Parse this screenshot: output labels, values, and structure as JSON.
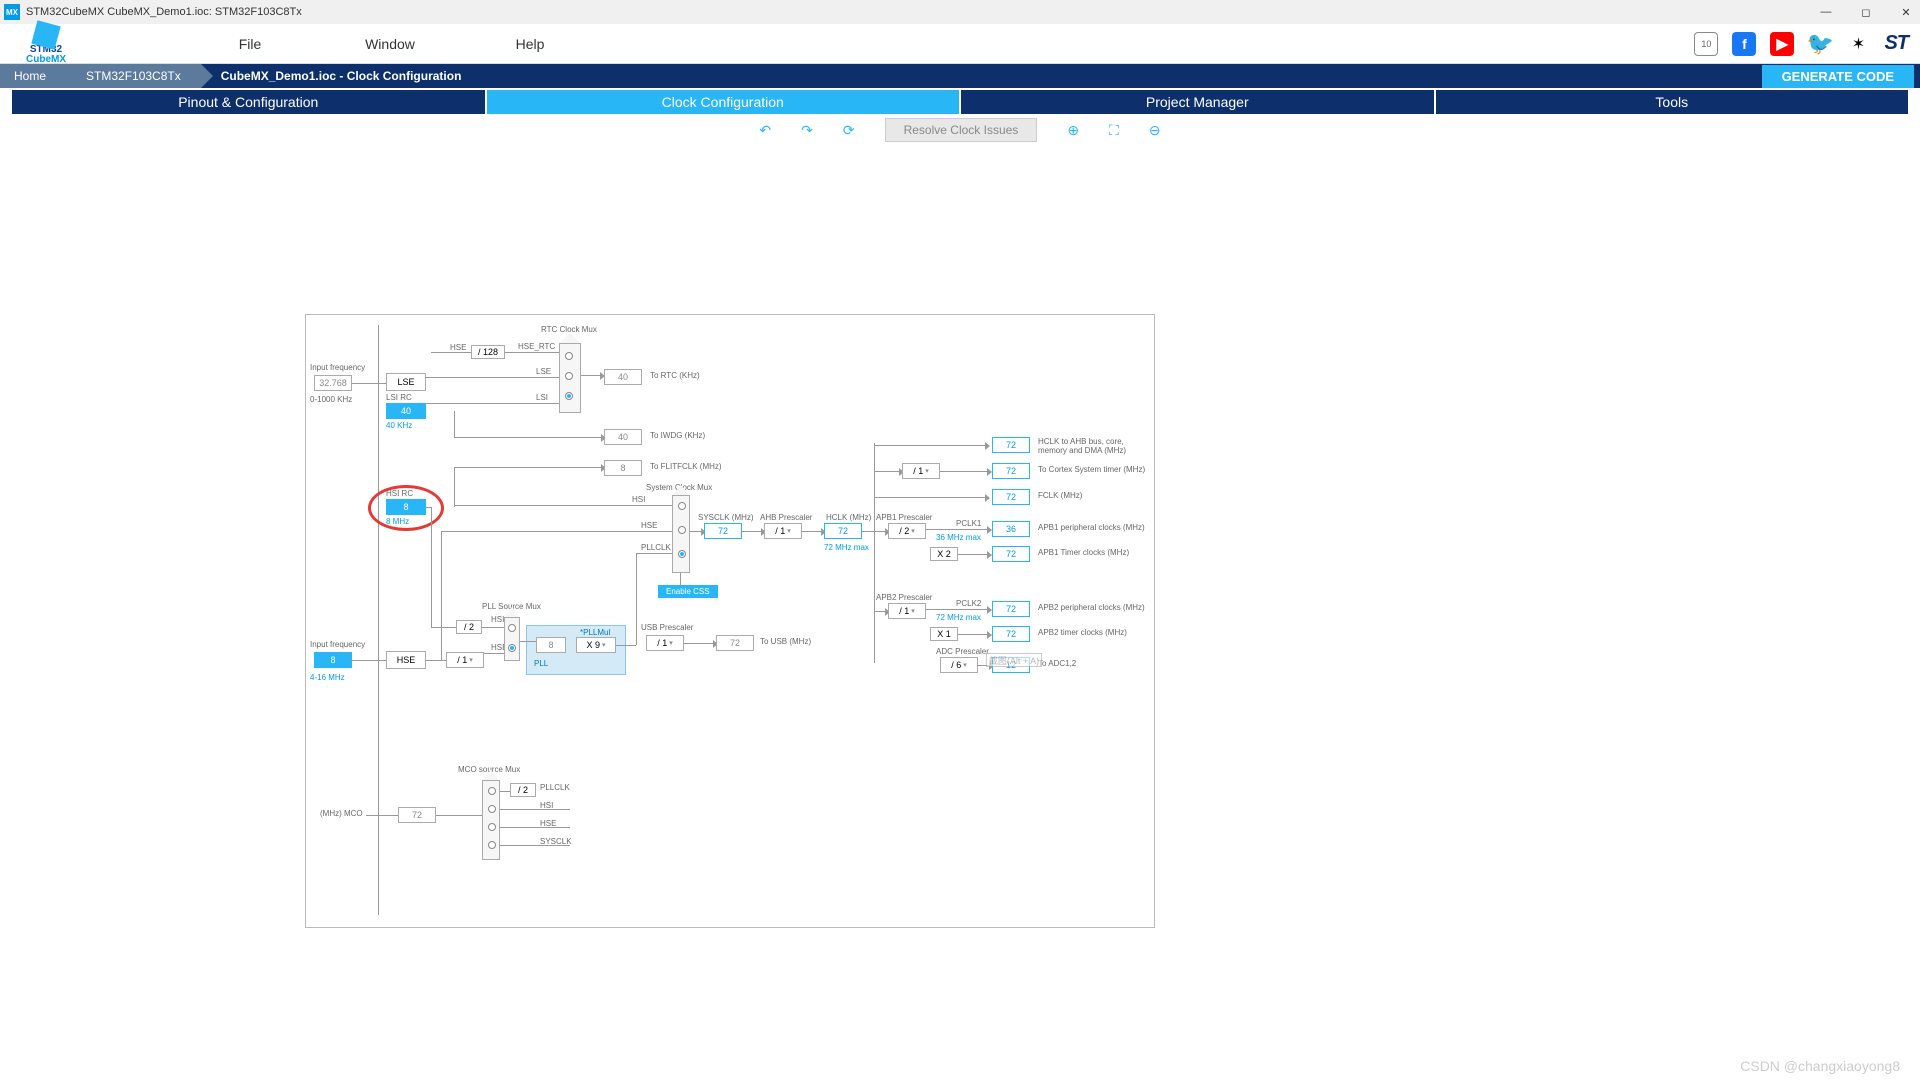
{
  "window": {
    "title": "STM32CubeMX CubeMX_Demo1.ioc: STM32F103C8Tx"
  },
  "logo": {
    "l1": "STM32",
    "l2": "CubeMX"
  },
  "menu": {
    "file": "File",
    "window": "Window",
    "help": "Help"
  },
  "social": {
    "badge": "10",
    "fb": "f",
    "yt": "▶",
    "tw": "🐦",
    "st": "ST"
  },
  "breadcrumb": {
    "home": "Home",
    "mcu": "STM32F103C8Tx",
    "proj": "CubeMX_Demo1.ioc - Clock Configuration",
    "gen": "GENERATE CODE"
  },
  "tabs": {
    "pinout": "Pinout & Configuration",
    "clock": "Clock Configuration",
    "pm": "Project Manager",
    "tools": "Tools"
  },
  "toolbar": {
    "resolve": "Resolve Clock Issues"
  },
  "clk": {
    "lse_in_lbl": "Input frequency",
    "lse_in": "32.768",
    "lse_range": "0-1000 KHz",
    "lse": "LSE",
    "lsi_lbl": "LSI RC",
    "lsi": "40",
    "lsi_note": "40 KHz",
    "hse_div128": "/ 128",
    "rtc_mux": "RTC Clock Mux",
    "rtc_to": "To RTC (KHz)",
    "rtc_val": "40",
    "iwdg_to": "To IWDG (KHz)",
    "iwdg_val": "40",
    "hsi_lbl": "HSI RC",
    "hsi": "8",
    "hsi_note": "8 MHz",
    "flitf_val": "8",
    "flitf_to": "To FLITFCLK (MHz)",
    "hse_in_lbl": "Input frequency",
    "hse_in": "8",
    "hse_range": "4-16 MHz",
    "hse": "HSE",
    "hse_div": "/ 1",
    "pll_src": "PLL Source Mux",
    "hsi_div2": "/ 2",
    "hsi_sig": "HSI",
    "hse_sig": "HSE",
    "pllmul_lbl": "*PLLMul",
    "pll_in": "8",
    "pllmul": "X 9",
    "pll": "PLL",
    "sys_mux": "System Clock Mux",
    "s_hsi": "HSI",
    "s_hse": "HSE",
    "s_pll": "PLLCLK",
    "sysclk_lbl": "SYSCLK (MHz)",
    "sysclk": "72",
    "ahb_lbl": "AHB Prescaler",
    "ahb": "/ 1",
    "hclk_lbl": "HCLK (MHz)",
    "hclk": "72",
    "hclk_max": "72 MHz max",
    "enable_css": "Enable CSS",
    "usb_lbl": "USB Prescaler",
    "usb_div": "/ 1",
    "usb_val": "72",
    "usb_to": "To USB (MHz)",
    "apb1_lbl": "APB1 Prescaler",
    "apb1": "/ 2",
    "apb1_max": "36 MHz max",
    "pclk1_lbl": "PCLK1",
    "apb1_x2": "X 2",
    "apb2_lbl": "APB2 Prescaler",
    "apb2": "/ 1",
    "apb2_max": "72 MHz max",
    "pclk2_lbl": "PCLK2",
    "apb2_x1": "X 1",
    "adc_lbl": "ADC Prescaler",
    "adc": "/ 6",
    "ahb_div1": "/ 1",
    "out_hclk": "72",
    "out_hclk_to": "HCLK to AHB bus, core, memory and DMA (MHz)",
    "out_cortex": "72",
    "out_cortex_to": "To Cortex System timer (MHz)",
    "out_fclk": "72",
    "out_fclk_to": "FCLK (MHz)",
    "out_pclk1": "36",
    "out_pclk1_to": "APB1 peripheral clocks (MHz)",
    "out_tim1": "72",
    "out_tim1_to": "APB1 Timer clocks (MHz)",
    "out_pclk2": "72",
    "out_pclk2_to": "APB2 peripheral clocks (MHz)",
    "out_tim2": "72",
    "out_tim2_to": "APB2 timer clocks (MHz)",
    "out_adc": "12",
    "out_adc_to": "To ADC1,2",
    "mco_lbl": "MCO source Mux",
    "mco_div2": "/ 2",
    "mco_pll": "PLLCLK",
    "mco_hsi": "HSI",
    "mco_hse": "HSE",
    "mco_sys": "SYSCLK",
    "mco_out_lbl": "(MHz) MCO",
    "mco_out": "72",
    "hse_rtc": "HSE_RTC",
    "sig_lse": "LSE",
    "sig_lsi": "LSI",
    "sig_hse": "HSE",
    "alt_hint": "截图(Alt + A)"
  },
  "watermark": "CSDN @changxiaoyong8"
}
